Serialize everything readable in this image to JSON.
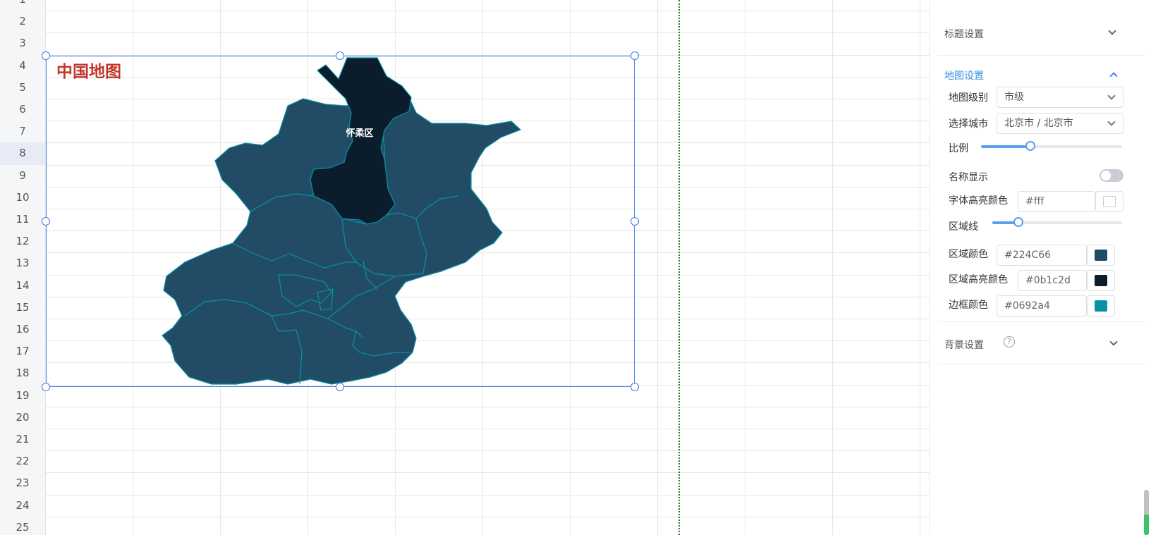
{
  "sheet": {
    "row_numbers": [
      "1",
      "2",
      "3",
      "4",
      "5",
      "6",
      "7",
      "8",
      "9",
      "10",
      "11",
      "12",
      "13",
      "14",
      "15",
      "16",
      "17",
      "18",
      "19",
      "20",
      "21",
      "22",
      "23",
      "24",
      "25"
    ],
    "selected_row": "8"
  },
  "chart": {
    "title": "中国地图",
    "highlight_label": "怀柔区",
    "area_color": "#224C66",
    "highlight_color": "#0b1c2d",
    "border_color": "#0692a4"
  },
  "panel": {
    "title_section": "标题设置",
    "map_section": "地图设置",
    "map_level_label": "地图级别",
    "map_level_value": "市级",
    "city_label": "选择城市",
    "city_value": "北京市 / 北京市",
    "scale_label": "比例",
    "scale_value": 0.35,
    "name_display_label": "名称显示",
    "name_display_on": false,
    "font_highlight_label": "字体高亮颜色",
    "font_highlight_value": "#fff",
    "region_line_label": "区域线",
    "region_line_value": 0.2,
    "region_color_label": "区域颜色",
    "region_color_value": "#224C66",
    "region_highlight_label": "区域高亮颜色",
    "region_highlight_value": "#0b1c2d",
    "border_color_label": "边框颜色",
    "border_color_value": "#0692a4",
    "background_section": "背景设置",
    "help_glyph": "?"
  }
}
